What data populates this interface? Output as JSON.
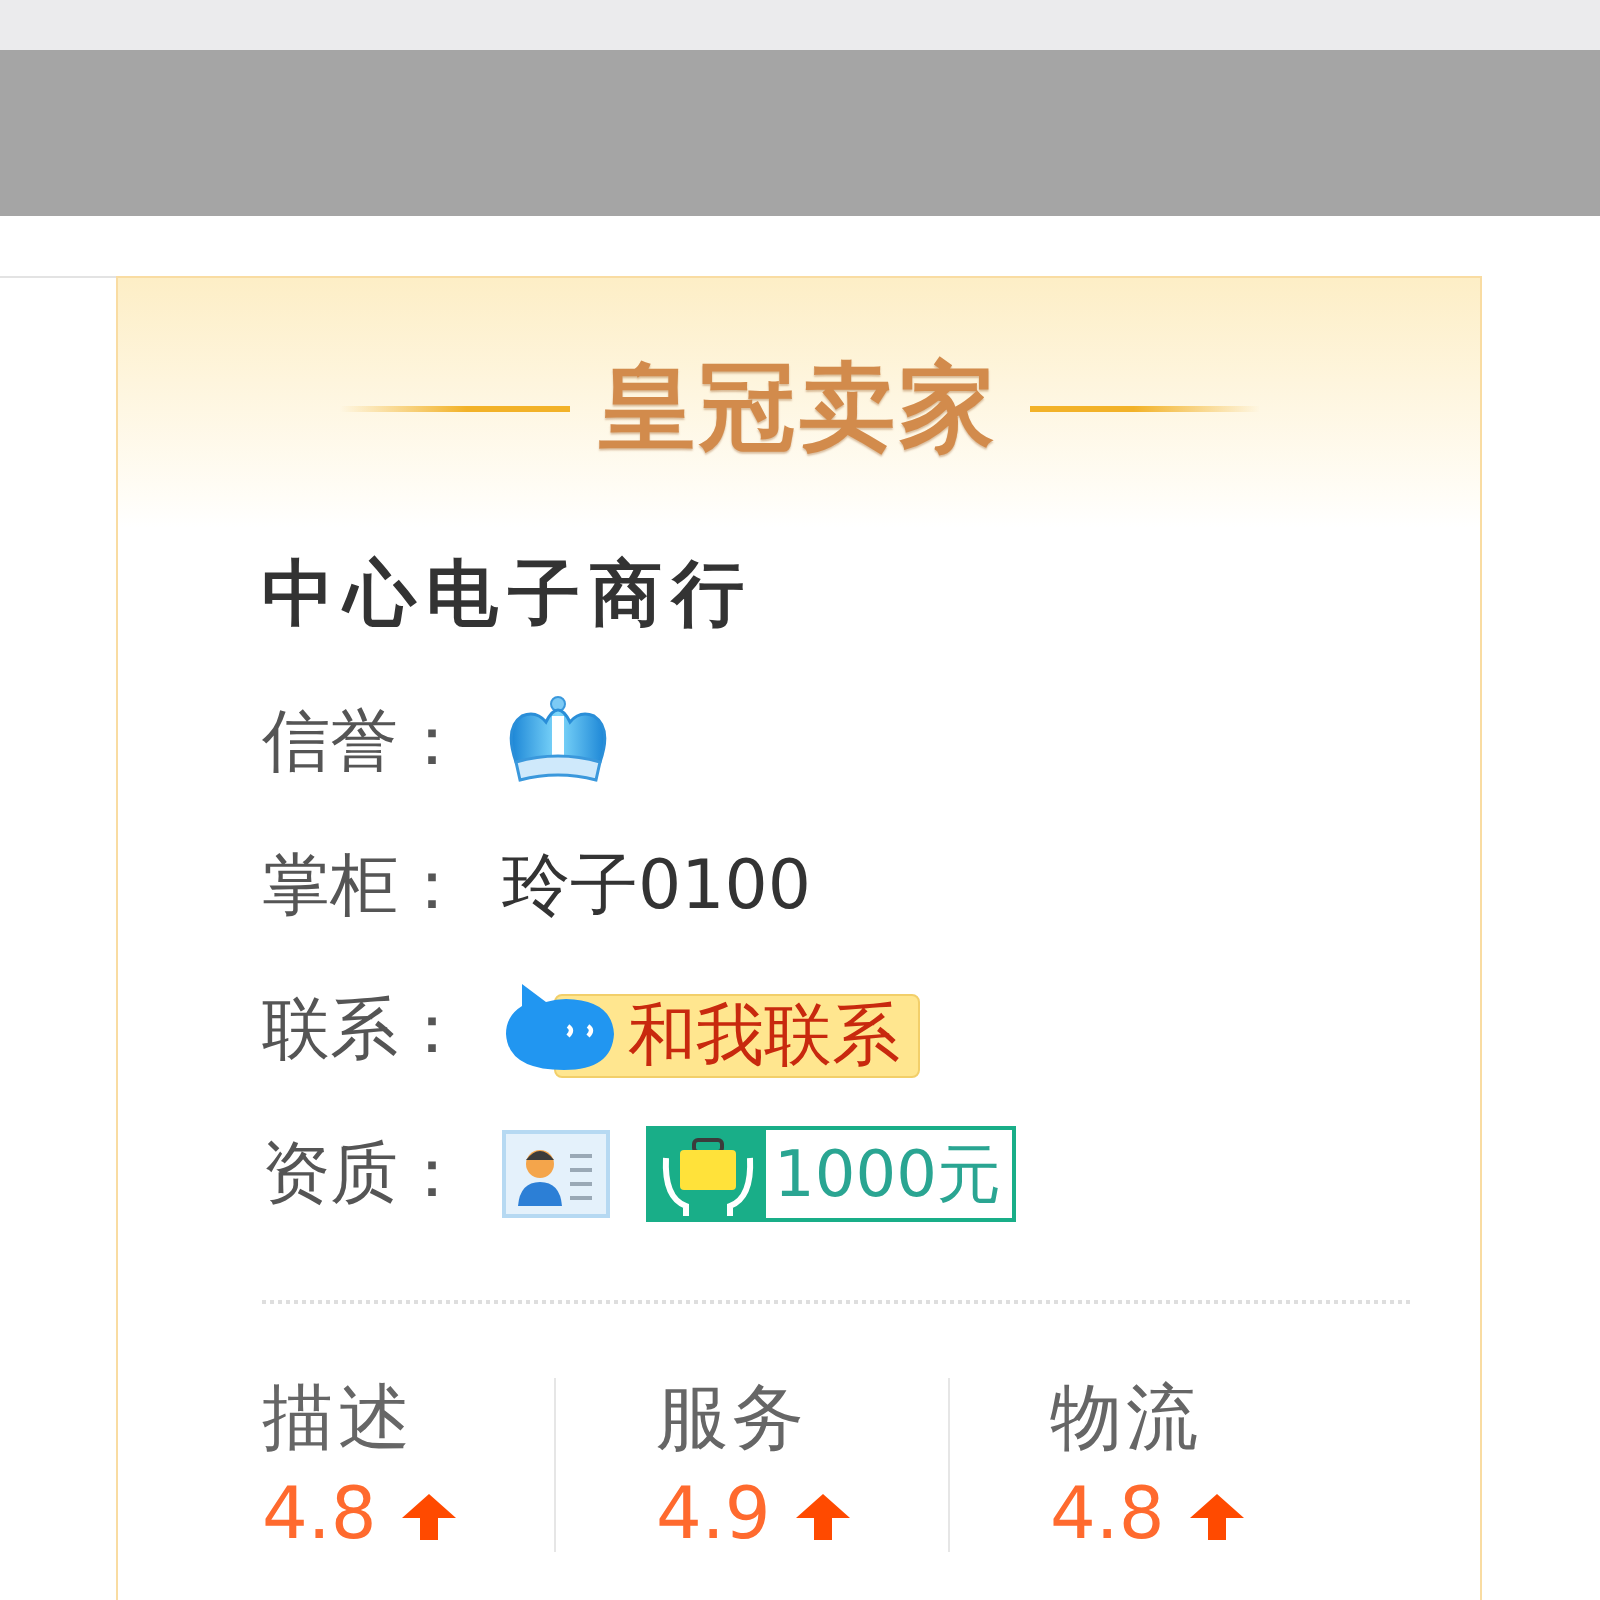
{
  "header": {
    "title": "皇冠卖家"
  },
  "shop": {
    "name": "中心电子商行"
  },
  "info_rows": [
    {
      "kind": "credit",
      "label": "信誉："
    },
    {
      "kind": "text",
      "label": "掌柜：",
      "value": "玲子0100"
    },
    {
      "kind": "contact",
      "label": "联系：",
      "button": "和我联系"
    },
    {
      "kind": "qualification",
      "label": "资质：",
      "deposit": "1000元"
    }
  ],
  "ratings": [
    {
      "label": "描述",
      "score": "4.8",
      "rising": true
    },
    {
      "label": "服务",
      "score": "4.9",
      "rising": true
    },
    {
      "label": "物流",
      "score": "4.8",
      "rising": true
    }
  ]
}
